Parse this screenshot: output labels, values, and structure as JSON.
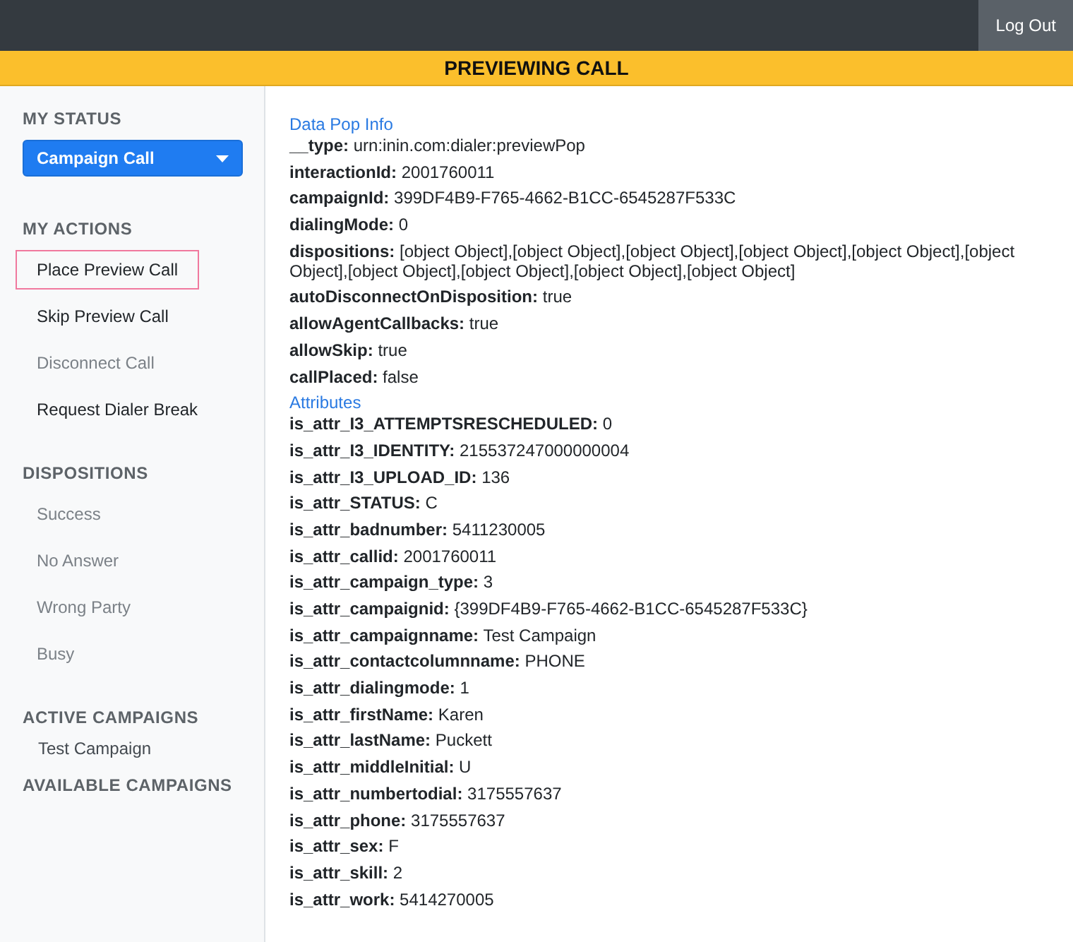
{
  "top_bar": {
    "logout_button": "Log Out"
  },
  "banner": {
    "title": "PREVIEWING CALL"
  },
  "sidebar": {
    "sections": [
      {
        "kind": "status",
        "heading": "MY STATUS",
        "dropdown": {
          "value": "Campaign Call"
        }
      },
      {
        "kind": "list",
        "heading": "MY ACTIONS",
        "items": [
          {
            "label": "Place Preview Call",
            "selected": true,
            "disabled": false
          },
          {
            "label": "Skip Preview Call",
            "selected": false,
            "disabled": false
          },
          {
            "label": "Disconnect Call",
            "selected": false,
            "disabled": true
          },
          {
            "label": "Request Dialer Break",
            "selected": false,
            "disabled": false
          }
        ]
      },
      {
        "kind": "list",
        "heading": "DISPOSITIONS",
        "items": [
          {
            "label": "Success",
            "selected": false,
            "disabled": true
          },
          {
            "label": "No Answer",
            "selected": false,
            "disabled": true
          },
          {
            "label": "Wrong Party",
            "selected": false,
            "disabled": true
          },
          {
            "label": "Busy",
            "selected": false,
            "disabled": true
          }
        ]
      },
      {
        "kind": "campaigns",
        "heading": "ACTIVE CAMPAIGNS",
        "items": [
          {
            "label": "Test Campaign"
          }
        ]
      },
      {
        "kind": "campaigns",
        "heading": "AVAILABLE CAMPAIGNS"
      }
    ]
  },
  "content": {
    "groups": [
      {
        "title": "Data Pop Info",
        "fields": [
          {
            "key": "__type:",
            "value": "urn:inin.com:dialer:previewPop"
          },
          {
            "key": "interactionId:",
            "value": "2001760011"
          },
          {
            "key": "campaignId:",
            "value": "399DF4B9-F765-4662-B1CC-6545287F533C"
          },
          {
            "key": "dialingMode:",
            "value": "0"
          },
          {
            "key": "dispositions:",
            "value": "[object Object],[object Object],[object Object],[object Object],[object Object],[object Object],[object Object],[object Object],[object Object],[object Object]"
          },
          {
            "key": "autoDisconnectOnDisposition:",
            "value": "true"
          },
          {
            "key": "allowAgentCallbacks:",
            "value": "true"
          },
          {
            "key": "allowSkip:",
            "value": "true"
          },
          {
            "key": "callPlaced:",
            "value": "false"
          }
        ]
      },
      {
        "title": "Attributes",
        "fields": [
          {
            "key": "is_attr_I3_ATTEMPTSRESCHEDULED:",
            "value": "0"
          },
          {
            "key": "is_attr_I3_IDENTITY:",
            "value": "215537247000000004"
          },
          {
            "key": "is_attr_I3_UPLOAD_ID:",
            "value": "136"
          },
          {
            "key": "is_attr_STATUS:",
            "value": "C"
          },
          {
            "key": "is_attr_badnumber:",
            "value": "5411230005"
          },
          {
            "key": "is_attr_callid:",
            "value": "2001760011"
          },
          {
            "key": "is_attr_campaign_type:",
            "value": "3"
          },
          {
            "key": "is_attr_campaignid:",
            "value": "{399DF4B9-F765-4662-B1CC-6545287F533C}"
          },
          {
            "key": "is_attr_campaignname:",
            "value": "Test Campaign"
          },
          {
            "key": "is_attr_contactcolumnname:",
            "value": "PHONE"
          },
          {
            "key": "is_attr_dialingmode:",
            "value": "1"
          },
          {
            "key": "is_attr_firstName:",
            "value": "Karen"
          },
          {
            "key": "is_attr_lastName:",
            "value": "Puckett"
          },
          {
            "key": "is_attr_middleInitial:",
            "value": "U"
          },
          {
            "key": "is_attr_numbertodial:",
            "value": "3175557637"
          },
          {
            "key": "is_attr_phone:",
            "value": "3175557637"
          },
          {
            "key": "is_attr_sex:",
            "value": "F"
          },
          {
            "key": "is_attr_skill:",
            "value": "2"
          },
          {
            "key": "is_attr_work:",
            "value": "5414270005"
          }
        ]
      }
    ]
  }
}
